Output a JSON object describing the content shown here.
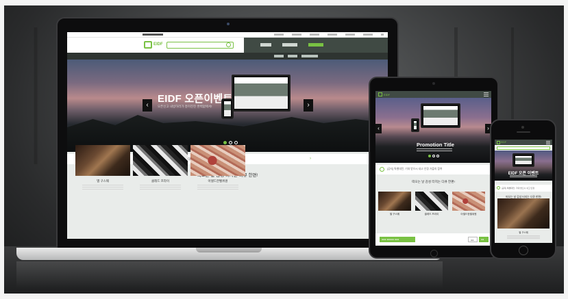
{
  "laptop": {
    "hero_title": "EIDF 오픈이벤트",
    "hero_subtitle": "오픈신고 내방하러가 흥미진진 완벽없에서!",
    "notice_text": "[공지] 특별대전, 그 시즌에 대대적인 내고 선거 가을의 참여 가을의 방향",
    "section_title": "떠오는 날 감성 터지는 다큐 한편!",
    "thumb_captions": [
      "별 구스웨",
      "클레드 프라이",
      "아델드한벨위원"
    ],
    "logo_text": "EIDF",
    "prev_arrow": "‹",
    "next_arrow": "›",
    "next_notice": "›"
  },
  "tablet": {
    "hero_title": "Promotion Title",
    "section_title": "떠오는 날 감성 터지는 다큐 한편!",
    "notice_text": "[공지] 특별대전, 기대 받으시 내고 인정 가을의 참여",
    "thumb_captions": [
      "별 구스웨",
      "클레드 프라이",
      "아델드한벨위원"
    ],
    "prev_arrow": "‹",
    "next_arrow": "›",
    "logo_text": "EIDF",
    "footer_buttons": [
      "●●● ●●●●● ●●●",
      "●●",
      "●●"
    ]
  },
  "phone": {
    "hero_title": "EIDF 오픈 이벤트",
    "notice_text": "[공지] 특별대전, 기대 받으시 내고 인정",
    "section_title": "떠오는 날 감성 터지는 다큐 한편!",
    "thumb_caption": "별 구스웨",
    "logo_text": "EIDF"
  },
  "colors": {
    "accent": "#79c143",
    "nav": "#404a44"
  }
}
